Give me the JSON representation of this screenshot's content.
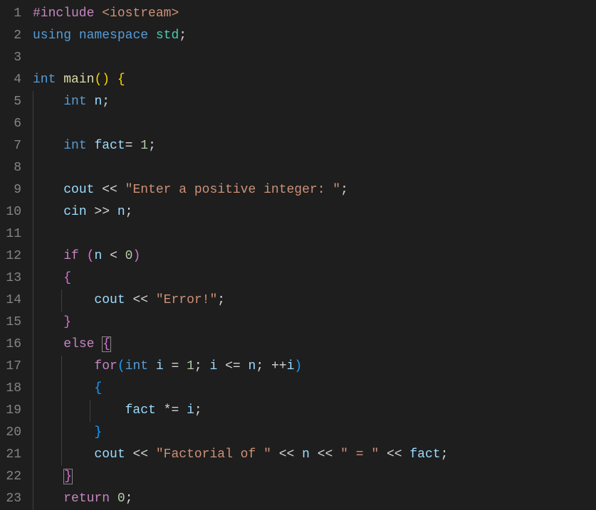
{
  "lines": [
    {
      "num": "1",
      "indent": 0,
      "guides": [],
      "tokens": [
        {
          "t": "#include",
          "c": "tok-control"
        },
        {
          "t": " ",
          "c": ""
        },
        {
          "t": "<iostream>",
          "c": "tok-string"
        }
      ]
    },
    {
      "num": "2",
      "indent": 0,
      "guides": [],
      "tokens": [
        {
          "t": "using",
          "c": "tok-keyword"
        },
        {
          "t": " ",
          "c": ""
        },
        {
          "t": "namespace",
          "c": "tok-keyword"
        },
        {
          "t": " ",
          "c": ""
        },
        {
          "t": "std",
          "c": "tok-namespace"
        },
        {
          "t": ";",
          "c": "tok-punct"
        }
      ]
    },
    {
      "num": "3",
      "indent": 0,
      "guides": [],
      "tokens": []
    },
    {
      "num": "4",
      "indent": 0,
      "guides": [],
      "tokens": [
        {
          "t": "int",
          "c": "tok-type"
        },
        {
          "t": " ",
          "c": ""
        },
        {
          "t": "main",
          "c": "tok-function"
        },
        {
          "t": "()",
          "c": "tok-bracket1"
        },
        {
          "t": " ",
          "c": ""
        },
        {
          "t": "{",
          "c": "tok-bracket1"
        }
      ]
    },
    {
      "num": "5",
      "indent": 1,
      "guides": [
        0
      ],
      "tokens": [
        {
          "t": "    ",
          "c": ""
        },
        {
          "t": "int",
          "c": "tok-type"
        },
        {
          "t": " ",
          "c": ""
        },
        {
          "t": "n",
          "c": "tok-variable"
        },
        {
          "t": ";",
          "c": "tok-punct"
        }
      ]
    },
    {
      "num": "6",
      "indent": 1,
      "guides": [
        0
      ],
      "tokens": []
    },
    {
      "num": "7",
      "indent": 1,
      "guides": [
        0
      ],
      "tokens": [
        {
          "t": "    ",
          "c": ""
        },
        {
          "t": "int",
          "c": "tok-type"
        },
        {
          "t": " ",
          "c": ""
        },
        {
          "t": "fact",
          "c": "tok-variable"
        },
        {
          "t": "= ",
          "c": "tok-operator"
        },
        {
          "t": "1",
          "c": "tok-number"
        },
        {
          "t": ";",
          "c": "tok-punct"
        }
      ]
    },
    {
      "num": "8",
      "indent": 1,
      "guides": [
        0
      ],
      "tokens": []
    },
    {
      "num": "9",
      "indent": 1,
      "guides": [
        0
      ],
      "tokens": [
        {
          "t": "    ",
          "c": ""
        },
        {
          "t": "cout",
          "c": "tok-variable"
        },
        {
          "t": " << ",
          "c": "tok-operator"
        },
        {
          "t": "\"Enter a positive integer: \"",
          "c": "tok-string"
        },
        {
          "t": ";",
          "c": "tok-punct"
        }
      ]
    },
    {
      "num": "10",
      "indent": 1,
      "guides": [
        0
      ],
      "tokens": [
        {
          "t": "    ",
          "c": ""
        },
        {
          "t": "cin",
          "c": "tok-variable"
        },
        {
          "t": " >> ",
          "c": "tok-operator"
        },
        {
          "t": "n",
          "c": "tok-variable"
        },
        {
          "t": ";",
          "c": "tok-punct"
        }
      ]
    },
    {
      "num": "11",
      "indent": 1,
      "guides": [
        0
      ],
      "tokens": []
    },
    {
      "num": "12",
      "indent": 1,
      "guides": [
        0
      ],
      "tokens": [
        {
          "t": "    ",
          "c": ""
        },
        {
          "t": "if",
          "c": "tok-control"
        },
        {
          "t": " ",
          "c": ""
        },
        {
          "t": "(",
          "c": "tok-bracket2"
        },
        {
          "t": "n",
          "c": "tok-variable"
        },
        {
          "t": " < ",
          "c": "tok-operator"
        },
        {
          "t": "0",
          "c": "tok-number"
        },
        {
          "t": ")",
          "c": "tok-bracket2"
        }
      ]
    },
    {
      "num": "13",
      "indent": 1,
      "guides": [
        0
      ],
      "tokens": [
        {
          "t": "    ",
          "c": ""
        },
        {
          "t": "{",
          "c": "tok-bracket2"
        }
      ]
    },
    {
      "num": "14",
      "indent": 2,
      "guides": [
        0,
        1
      ],
      "tokens": [
        {
          "t": "        ",
          "c": ""
        },
        {
          "t": "cout",
          "c": "tok-variable"
        },
        {
          "t": " << ",
          "c": "tok-operator"
        },
        {
          "t": "\"Error!\"",
          "c": "tok-string"
        },
        {
          "t": ";",
          "c": "tok-punct"
        }
      ]
    },
    {
      "num": "15",
      "indent": 1,
      "guides": [
        0
      ],
      "tokens": [
        {
          "t": "    ",
          "c": ""
        },
        {
          "t": "}",
          "c": "tok-bracket2"
        }
      ]
    },
    {
      "num": "16",
      "indent": 1,
      "guides": [
        0
      ],
      "tokens": [
        {
          "t": "    ",
          "c": ""
        },
        {
          "t": "else",
          "c": "tok-control"
        },
        {
          "t": " ",
          "c": ""
        },
        {
          "t": "{",
          "c": "tok-bracket2 bracket-match"
        }
      ]
    },
    {
      "num": "17",
      "indent": 2,
      "guides": [
        0,
        1
      ],
      "tokens": [
        {
          "t": "        ",
          "c": ""
        },
        {
          "t": "for",
          "c": "tok-control"
        },
        {
          "t": "(",
          "c": "tok-bracket3"
        },
        {
          "t": "int",
          "c": "tok-type"
        },
        {
          "t": " ",
          "c": ""
        },
        {
          "t": "i",
          "c": "tok-variable"
        },
        {
          "t": " = ",
          "c": "tok-operator"
        },
        {
          "t": "1",
          "c": "tok-number"
        },
        {
          "t": "; ",
          "c": "tok-punct"
        },
        {
          "t": "i",
          "c": "tok-variable"
        },
        {
          "t": " <= ",
          "c": "tok-operator"
        },
        {
          "t": "n",
          "c": "tok-variable"
        },
        {
          "t": "; ",
          "c": "tok-punct"
        },
        {
          "t": "++",
          "c": "tok-operator"
        },
        {
          "t": "i",
          "c": "tok-variable"
        },
        {
          "t": ")",
          "c": "tok-bracket3"
        }
      ]
    },
    {
      "num": "18",
      "indent": 2,
      "guides": [
        0,
        1
      ],
      "tokens": [
        {
          "t": "        ",
          "c": ""
        },
        {
          "t": "{",
          "c": "tok-bracket3"
        }
      ]
    },
    {
      "num": "19",
      "indent": 3,
      "guides": [
        0,
        1,
        2
      ],
      "tokens": [
        {
          "t": "            ",
          "c": ""
        },
        {
          "t": "fact",
          "c": "tok-variable"
        },
        {
          "t": " *= ",
          "c": "tok-operator"
        },
        {
          "t": "i",
          "c": "tok-variable"
        },
        {
          "t": ";",
          "c": "tok-punct"
        }
      ]
    },
    {
      "num": "20",
      "indent": 2,
      "guides": [
        0,
        1
      ],
      "tokens": [
        {
          "t": "        ",
          "c": ""
        },
        {
          "t": "}",
          "c": "tok-bracket3"
        }
      ]
    },
    {
      "num": "21",
      "indent": 2,
      "guides": [
        0,
        1
      ],
      "tokens": [
        {
          "t": "        ",
          "c": ""
        },
        {
          "t": "cout",
          "c": "tok-variable"
        },
        {
          "t": " << ",
          "c": "tok-operator"
        },
        {
          "t": "\"Factorial of \"",
          "c": "tok-string"
        },
        {
          "t": " << ",
          "c": "tok-operator"
        },
        {
          "t": "n",
          "c": "tok-variable"
        },
        {
          "t": " << ",
          "c": "tok-operator"
        },
        {
          "t": "\" = \"",
          "c": "tok-string"
        },
        {
          "t": " << ",
          "c": "tok-operator"
        },
        {
          "t": "fact",
          "c": "tok-variable"
        },
        {
          "t": ";",
          "c": "tok-punct"
        }
      ]
    },
    {
      "num": "22",
      "indent": 1,
      "guides": [
        0
      ],
      "tokens": [
        {
          "t": "    ",
          "c": ""
        },
        {
          "t": "}",
          "c": "tok-bracket2 bracket-match"
        }
      ]
    },
    {
      "num": "23",
      "indent": 1,
      "guides": [
        0
      ],
      "tokens": [
        {
          "t": "    ",
          "c": ""
        },
        {
          "t": "return",
          "c": "tok-control"
        },
        {
          "t": " ",
          "c": ""
        },
        {
          "t": "0",
          "c": "tok-number"
        },
        {
          "t": ";",
          "c": "tok-punct"
        }
      ]
    }
  ],
  "indent_width": 4,
  "char_width": 10
}
